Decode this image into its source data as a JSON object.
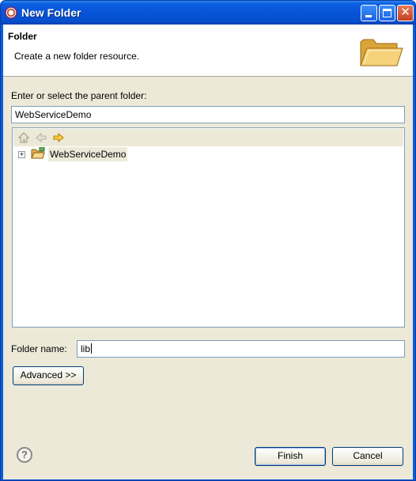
{
  "window": {
    "title": "New Folder",
    "controls": {
      "minimize": "minimize-icon",
      "maximize": "maximize-icon",
      "close": "close-icon",
      "close_glyph": "✕"
    }
  },
  "banner": {
    "title": "Folder",
    "description": "Create a new folder resource.",
    "icon": "folder-open-icon"
  },
  "parent": {
    "label": "Enter or select the parent folder:",
    "value": "WebServiceDemo"
  },
  "tree": {
    "toolbar": [
      "home-icon",
      "back-arrow-icon",
      "forward-arrow-icon"
    ],
    "items": [
      {
        "label": "WebServiceDemo",
        "expander": "+",
        "icon": "project-folder-icon"
      }
    ]
  },
  "folder_name": {
    "label": "Folder name:",
    "value": "lib"
  },
  "buttons": {
    "advanced": "Advanced >>",
    "finish": "Finish",
    "cancel": "Cancel",
    "help": "?"
  },
  "colors": {
    "titlebar": "#0754d8",
    "dialog_bg": "#ece9d8",
    "field_border": "#7f9db9"
  }
}
